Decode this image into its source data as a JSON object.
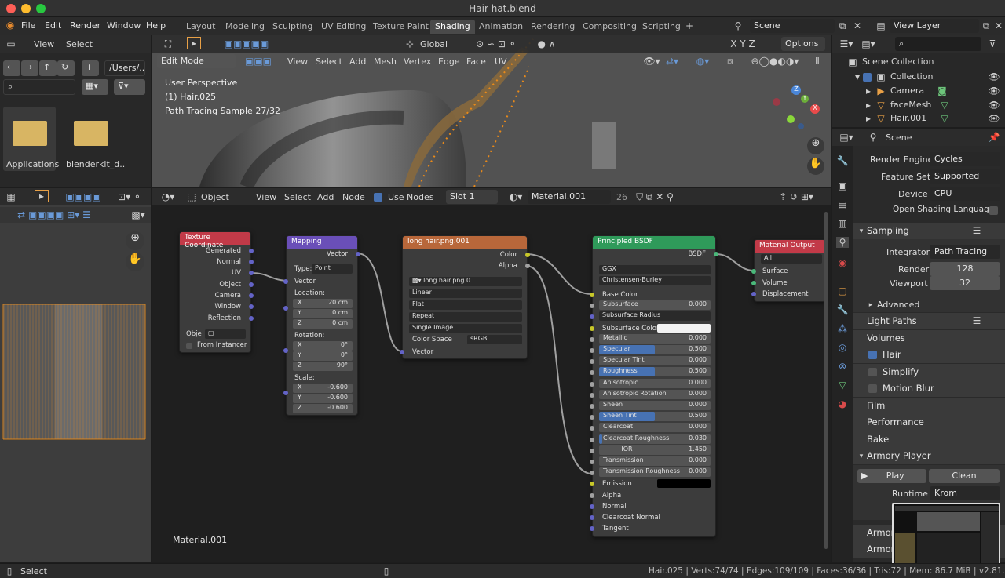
{
  "window": {
    "title": "Hair hat.blend"
  },
  "menu": [
    "File",
    "Edit",
    "Render",
    "Window",
    "Help"
  ],
  "workspaces": [
    "Layout",
    "Modeling",
    "Sculpting",
    "UV Editing",
    "Texture Paint",
    "Shading",
    "Animation",
    "Rendering",
    "Compositing",
    "Scripting"
  ],
  "active_workspace": "Shading",
  "scene": {
    "label": "Scene",
    "view_layer": "View Layer"
  },
  "filebrowser": {
    "view": "View",
    "select": "Select",
    "path": "/Users/..",
    "items": [
      {
        "label": "Applications"
      },
      {
        "label": "blenderkit_d.."
      }
    ]
  },
  "viewport": {
    "mode": "Edit Mode",
    "menus": [
      "View",
      "Select",
      "Add",
      "Mesh",
      "Vertex",
      "Edge",
      "Face",
      "UV"
    ],
    "orientation": "Global",
    "options": "Options",
    "overlay_lines": [
      "User Perspective",
      "(1) Hair.025",
      "Path Tracing Sample 27/32"
    ]
  },
  "node_editor": {
    "type": "Object",
    "menus": [
      "View",
      "Select",
      "Add",
      "Node"
    ],
    "use_nodes": "Use Nodes",
    "slot": "Slot 1",
    "material": "Material.001",
    "users": "26",
    "footer_label": "Material.001"
  },
  "nodes": {
    "texcoord": {
      "title": "Texture Coordinate",
      "outputs": [
        "Generated",
        "Normal",
        "UV",
        "Object",
        "Camera",
        "Window",
        "Reflection"
      ],
      "object_label": "Obje",
      "from_instancer": "From Instancer"
    },
    "mapping": {
      "title": "Mapping",
      "output": "Vector",
      "type_label": "Type:",
      "type_value": "Point",
      "input": "Vector",
      "location": "Location:",
      "rotation": "Rotation:",
      "scale": "Scale:",
      "loc": [
        {
          "a": "X",
          "v": "20 cm"
        },
        {
          "a": "Y",
          "v": "0 cm"
        },
        {
          "a": "Z",
          "v": "0 cm"
        }
      ],
      "rot": [
        {
          "a": "X",
          "v": "0°"
        },
        {
          "a": "Y",
          "v": "0°"
        },
        {
          "a": "Z",
          "v": "90°"
        }
      ],
      "scl": [
        {
          "a": "X",
          "v": "-0.600"
        },
        {
          "a": "Y",
          "v": "-0.600"
        },
        {
          "a": "Z",
          "v": "-0.600"
        }
      ]
    },
    "image": {
      "title": "long hair.png.001",
      "out_color": "Color",
      "out_alpha": "Alpha",
      "image_name": "long hair.png.0..",
      "interp": "Linear",
      "proj": "Flat",
      "ext": "Repeat",
      "source": "Single Image",
      "cs_label": "Color Space",
      "cs_value": "sRGB",
      "input": "Vector"
    },
    "bsdf": {
      "title": "Principled BSDF",
      "output": "BSDF",
      "dist": "GGX",
      "sss_method": "Christensen-Burley",
      "rows": [
        {
          "label": "Base Color",
          "kind": "socket"
        },
        {
          "label": "Subsurface",
          "value": "0.000",
          "fill": 0
        },
        {
          "label": "Subsurface Radius",
          "kind": "dd"
        },
        {
          "label": "Subsurface Color",
          "kind": "color"
        },
        {
          "label": "Metallic",
          "value": "0.000",
          "fill": 0
        },
        {
          "label": "Specular",
          "value": "0.500",
          "fill": 0.5
        },
        {
          "label": "Specular Tint",
          "value": "0.000",
          "fill": 0
        },
        {
          "label": "Roughness",
          "value": "0.500",
          "fill": 0.5
        },
        {
          "label": "Anisotropic",
          "value": "0.000",
          "fill": 0
        },
        {
          "label": "Anisotropic Rotation",
          "value": "0.000",
          "fill": 0
        },
        {
          "label": "Sheen",
          "value": "0.000",
          "fill": 0
        },
        {
          "label": "Sheen Tint",
          "value": "0.500",
          "fill": 0.5
        },
        {
          "label": "Clearcoat",
          "value": "0.000",
          "fill": 0
        },
        {
          "label": "Clearcoat Roughness",
          "value": "0.030",
          "fill": 0.03
        },
        {
          "label": "IOR",
          "value": "1.450",
          "fill": 0,
          "center": true
        },
        {
          "label": "Transmission",
          "value": "0.000",
          "fill": 0
        },
        {
          "label": "Transmission Roughness",
          "value": "0.000",
          "fill": 0
        },
        {
          "label": "Emission",
          "kind": "black"
        },
        {
          "label": "Alpha",
          "kind": "socket"
        },
        {
          "label": "Normal",
          "kind": "socket"
        },
        {
          "label": "Clearcoat Normal",
          "kind": "socket"
        },
        {
          "label": "Tangent",
          "kind": "socket"
        }
      ]
    },
    "output": {
      "title": "Material Output",
      "target": "All",
      "inputs": [
        "Surface",
        "Volume",
        "Displacement"
      ]
    }
  },
  "outliner": {
    "root": "Scene Collection",
    "items": [
      "Collection",
      "Camera",
      "faceMesh",
      "Hair.001"
    ]
  },
  "properties": {
    "context": "Scene",
    "rows": [
      {
        "label": "Render Engine",
        "value": "Cycles"
      },
      {
        "label": "Feature Set",
        "value": "Supported"
      },
      {
        "label": "Device",
        "value": "CPU"
      }
    ],
    "osl": "Open Shading Language",
    "sampling": "Sampling",
    "integrator_label": "Integrator",
    "integrator": "Path Tracing",
    "render_label": "Render",
    "render": "128",
    "viewport_label": "Viewport",
    "viewport": "32",
    "advanced": "Advanced",
    "panels": [
      "Light Paths",
      "Volumes",
      "Hair",
      "Simplify",
      "Motion Blur",
      "Film",
      "Performance",
      "Bake",
      "Armory Player"
    ],
    "play": "Play",
    "clean": "Clean",
    "runtime_label": "Runtime",
    "runtime": "Krom",
    "armory_more": [
      "Armor",
      "Armor"
    ]
  },
  "status": {
    "left": "Select",
    "stats": "Hair.025 | Verts:74/74 | Edges:109/109 | Faces:36/36 | Tris:72 | Mem: 86.7 MiB | v2.81.16"
  }
}
